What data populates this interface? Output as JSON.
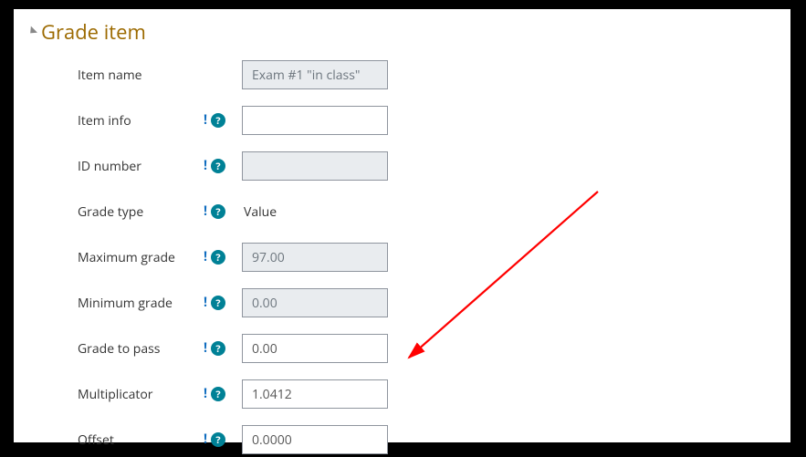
{
  "section": {
    "title": "Grade item"
  },
  "fields": {
    "item_name": {
      "label": "Item name",
      "value": "Exam #1 \"in class\""
    },
    "item_info": {
      "label": "Item info",
      "value": ""
    },
    "id_number": {
      "label": "ID number",
      "value": ""
    },
    "grade_type": {
      "label": "Grade type",
      "value": "Value"
    },
    "max_grade": {
      "label": "Maximum grade",
      "value": "97.00"
    },
    "min_grade": {
      "label": "Minimum grade",
      "value": "0.00"
    },
    "grade_pass": {
      "label": "Grade to pass",
      "value": "0.00"
    },
    "multiplicator": {
      "label": "Multiplicator",
      "value": "1.0412"
    },
    "offset": {
      "label": "Offset",
      "value": "0.0000"
    }
  },
  "colors": {
    "accent": "#008196",
    "heading": "#9c6a00",
    "arrow": "#ff0000"
  }
}
